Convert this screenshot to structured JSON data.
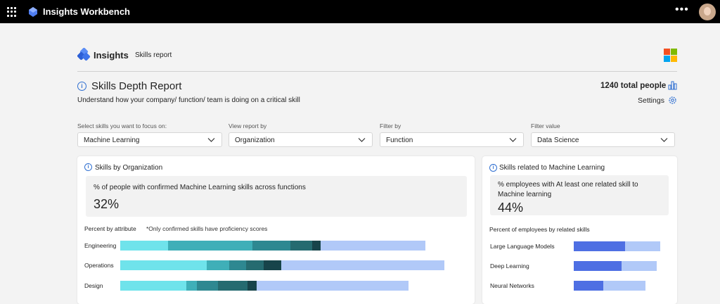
{
  "topbar": {
    "app_title": "Insights Workbench",
    "more_label": "•••"
  },
  "header": {
    "title": "Insights",
    "subtitle": "Skills report"
  },
  "report": {
    "title": "Skills Depth Report",
    "description": "Understand how your company/ function/ team is doing on a critical skill",
    "total": "1240 total people",
    "settings_label": "Settings"
  },
  "filters": [
    {
      "label": "Select skills you want to focus on:",
      "value": "Machine Learning"
    },
    {
      "label": "View report by",
      "value": "Organization"
    },
    {
      "label": "Filter by",
      "value": "Function"
    },
    {
      "label": "Filter value",
      "value": "Data Science"
    }
  ],
  "colors": {
    "accent": "#2f6fd1",
    "seg1": "#6fe3eb",
    "seg2": "#3fafb8",
    "seg3": "#2e8891",
    "seg4": "#256b70",
    "seg5": "#17444a",
    "seg6": "#b1c9f8",
    "blue_dark": "#4e6fe3",
    "blue_light": "#b1c9f8"
  },
  "org_card": {
    "title": "Skills by Organization",
    "stat_desc": "% of people with confirmed Machine Learning skills across functions",
    "stat_value": "32%",
    "section_label": "Percent by attribute",
    "note": "*Only confirmed skills have proficiency scores",
    "rows": [
      {
        "label": "Engineering",
        "segments": [
          13.6,
          24.0,
          10.7,
          6.2,
          2.4,
          29.8
        ]
      },
      {
        "label": "Operations",
        "segments": [
          24.6,
          6.4,
          4.7,
          5.1,
          4.9,
          46.4
        ]
      },
      {
        "label": "Design",
        "segments": [
          18.8,
          3.0,
          6.0,
          8.4,
          2.6,
          43.2
        ]
      }
    ]
  },
  "related_card": {
    "title": "Skills related to Machine Learning",
    "stat_desc": "% employees with At least one related skill to Machine learning",
    "stat_value": "44%",
    "section_label": "Percent of employees by related skills",
    "rows": [
      {
        "label": "Large Language Models",
        "primary": 58.4,
        "secondary": 40.0
      },
      {
        "label": "Deep Learning",
        "primary": 54.4,
        "secondary": 40.0
      },
      {
        "label": "Neural Networks",
        "primary": 33.6,
        "secondary": 48.0
      }
    ]
  }
}
